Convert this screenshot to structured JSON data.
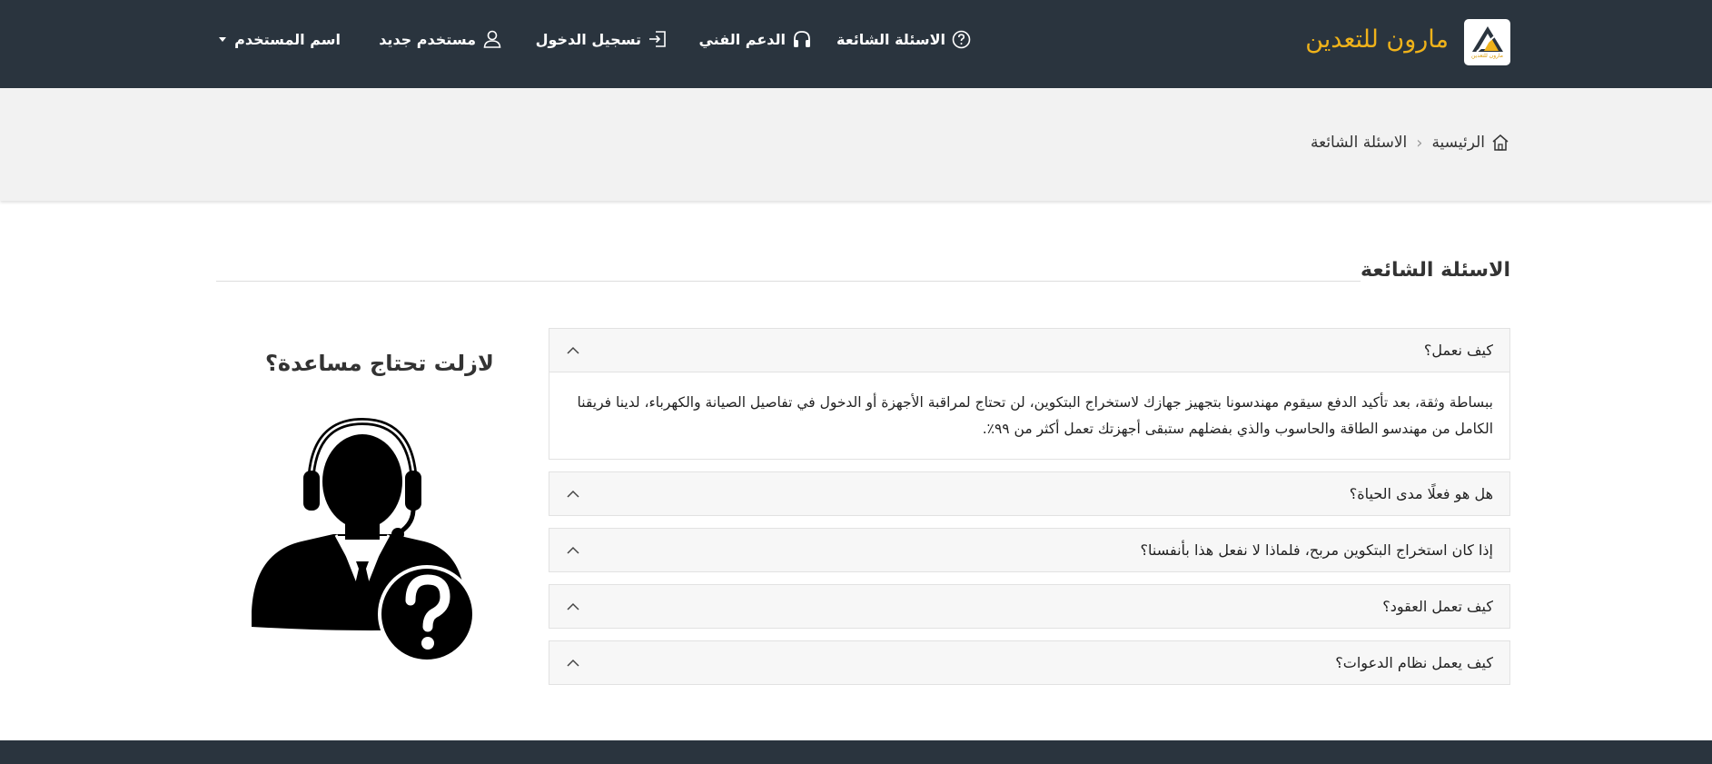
{
  "header": {
    "brand": "مارون للتعدين",
    "logo_caption": "مارون للتعدين",
    "nav": {
      "faq": "الاسئلة الشائعة",
      "support": "الدعم الفني",
      "login": "تسجيل الدخول",
      "register": "مستخدم جديد",
      "user": "اسم المستخدم"
    }
  },
  "breadcrumb": {
    "home": "الرئيسية",
    "current": "الاسئلة الشائعة"
  },
  "page": {
    "title": "الاسئلة الشائعة"
  },
  "faq": [
    {
      "question": "كيف نعمل؟",
      "answer": "ببساطة وثقة، بعد تأكيد الدفع سيقوم مهندسونا بتجهيز جهازك لاستخراج البتكوين، لن تحتاج لمراقبة الأجهزة أو الدخول في تفاصيل الصيانة والكهرباء، لدينا فريقنا الكامل من مهندسو الطاقة والحاسوب والذي بفضلهم ستبقى أجهزتك تعمل أكثر من ٩٩٪."
    },
    {
      "question": "هل هو فعلًا مدى الحياة؟"
    },
    {
      "question": "إذا كان استخراج البتكوين مربح، فلماذا لا نفعل هذا بأنفسنا؟"
    },
    {
      "question": "كيف تعمل العقود؟"
    },
    {
      "question": "كيف يعمل نظام الدعوات؟"
    }
  ],
  "aside": {
    "heading": "لازلت تحتاج مساعدة؟"
  },
  "colors": {
    "header_bg": "#2a343e",
    "brand": "#efb21a",
    "band_bg": "#f2f2f2"
  }
}
